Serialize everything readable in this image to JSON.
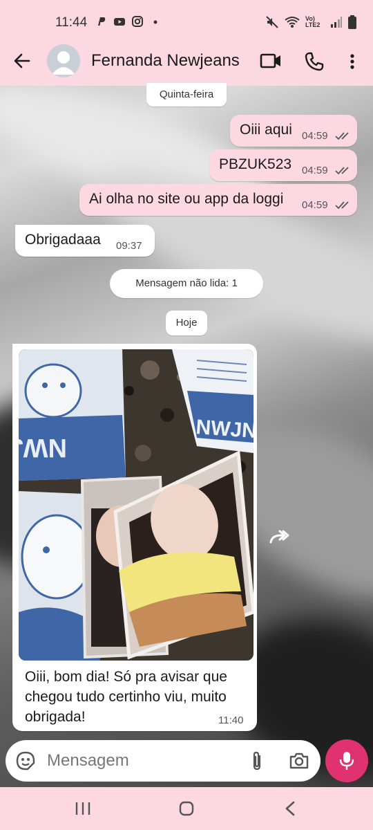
{
  "status_bar": {
    "time": "11:44",
    "network_label": "Vo) LTE2"
  },
  "header": {
    "contact_name": "Fernanda Newjeans",
    "icons": [
      "back-arrow-icon",
      "avatar",
      "video-call-icon",
      "phone-icon",
      "more-vertical-icon"
    ]
  },
  "chat": {
    "day_divider_1": "Quinta-feira",
    "messages_sent": [
      {
        "text": "Oiii aqui",
        "time": "04:59"
      },
      {
        "text": "PBZUK523",
        "time": "04:59"
      },
      {
        "text": "Ai olha no site ou app da loggi",
        "time": "04:59"
      }
    ],
    "message_received_1": {
      "text": "Obrigadaaa",
      "time": "09:37"
    },
    "unread_divider": "Mensagem não lida: 1",
    "day_divider_2": "Hoje",
    "photo_message": {
      "caption": "Oiii, bom dia! Só pra avisar que chegou tudo certinho viu, muito obrigada!",
      "time": "11:40",
      "photo_text": "NWJNS"
    }
  },
  "composer": {
    "placeholder": "Mensagem"
  },
  "colors": {
    "bar_pink": "#fbd8e2",
    "sent_bubble": "#fbd8e2",
    "received_bubble": "#ffffff",
    "mic_button": "#e0326f"
  }
}
